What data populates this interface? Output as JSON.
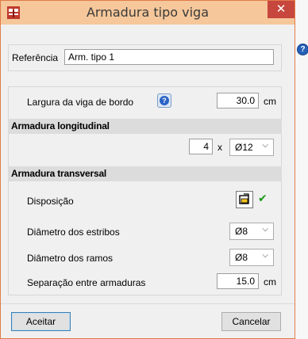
{
  "window": {
    "title": "Armadura tipo viga",
    "close_glyph": "✕",
    "help_glyph": "?",
    "accent_color": "#f5c79a"
  },
  "reference": {
    "label": "Referência",
    "value": "Arm. tipo 1"
  },
  "edge_beam": {
    "label": "Largura da viga de bordo",
    "value": "30.0",
    "unit": "cm",
    "help_glyph": "?"
  },
  "longitudinal": {
    "title": "Armadura longitudinal",
    "count": "4",
    "times": "x",
    "diameter": "Ø12"
  },
  "transverse": {
    "title": "Armadura transversal",
    "layout_label": "Disposição",
    "layout_check": "✔",
    "stirrup_label": "Diâmetro dos estribos",
    "stirrup_value": "Ø8",
    "legs_label": "Diâmetro dos ramos",
    "legs_value": "Ø8",
    "spacing_label": "Separação entre armaduras",
    "spacing_value": "15.0",
    "spacing_unit": "cm"
  },
  "footer": {
    "accept": "Aceitar",
    "cancel": "Cancelar"
  },
  "icons": {
    "chevron": "⌵"
  }
}
